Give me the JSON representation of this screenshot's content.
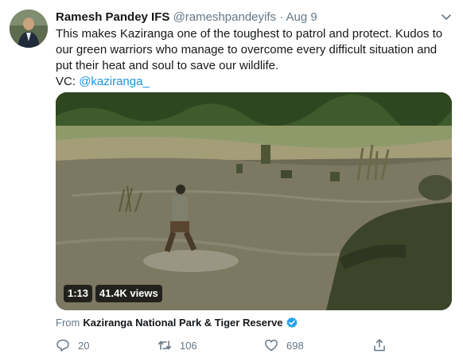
{
  "author": {
    "name": "Ramesh Pandey IFS",
    "handle": "@rameshpandeyifs",
    "separator": "·",
    "date": "Aug 9"
  },
  "tweet": {
    "line1": "This makes Kaziranga one of the toughest to patrol and protect. Kudos to",
    "line2": "our green warriors who manage to overcome every difficult situation and",
    "line3": "put their heat and soul to save our wildlife.",
    "vc_prefix": "VC: ",
    "vc_link": "@kaziranga_"
  },
  "video": {
    "duration": "1:13",
    "views": "41.4K views"
  },
  "source": {
    "prefix": "From",
    "name": "Kaziranga National Park & Tiger Reserve"
  },
  "actions": {
    "replies": "20",
    "retweets": "106",
    "likes": "698"
  },
  "colors": {
    "link": "#1b95e0",
    "muted": "#657786",
    "verified": "#1da1f2"
  }
}
